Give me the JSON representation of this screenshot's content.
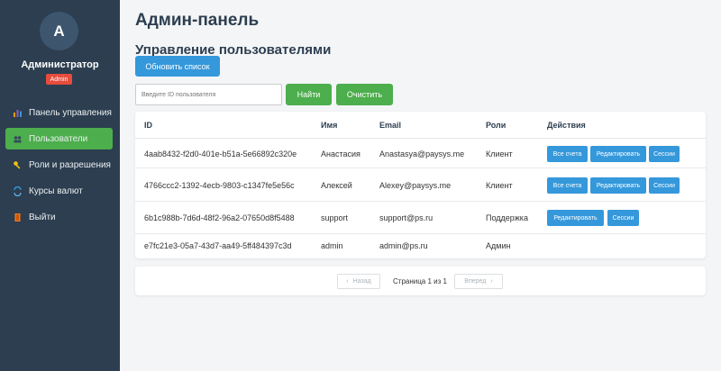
{
  "sidebar": {
    "avatar_letter": "A",
    "user_name": "Администратор",
    "role_badge": "Admin",
    "items": [
      {
        "label": "Панель управления",
        "icon": "dashboard-icon",
        "active": false
      },
      {
        "label": "Пользователи",
        "icon": "users-icon",
        "active": true
      },
      {
        "label": "Роли и разрешения",
        "icon": "key-icon",
        "active": false
      },
      {
        "label": "Курсы валют",
        "icon": "exchange-icon",
        "active": false
      },
      {
        "label": "Выйти",
        "icon": "logout-icon",
        "active": false
      }
    ]
  },
  "header": {
    "title": "Админ-панель",
    "section_title": "Управление пользователями"
  },
  "toolbar": {
    "refresh_label": "Обновить список",
    "search_placeholder": "Введите ID пользователя",
    "search_value": "",
    "find_label": "Найти",
    "clear_label": "Очистить"
  },
  "table": {
    "columns": [
      "ID",
      "Имя",
      "Email",
      "Роли",
      "Действия"
    ],
    "rows": [
      {
        "id": "4aab8432-f2d0-401e-b51a-5e66892c320e",
        "name": "Анастасия",
        "email": "Anastasya@paysys.me",
        "role": "Клиент",
        "actions": [
          "Все счета",
          "Редактировать",
          "Сессии"
        ]
      },
      {
        "id": "4766ccc2-1392-4ecb-9803-c1347fe5e56c",
        "name": "Алексей",
        "email": "Alexey@paysys.me",
        "role": "Клиент",
        "actions": [
          "Все счета",
          "Редактировать",
          "Сессии"
        ]
      },
      {
        "id": "6b1c988b-7d6d-48f2-96a2-07650d8f5488",
        "name": "support",
        "email": "support@ps.ru",
        "role": "Поддержка",
        "actions": [
          "Редактировать",
          "Сессии"
        ]
      },
      {
        "id": "e7fc21e3-05a7-43d7-aa49-5ff484397c3d",
        "name": "admin",
        "email": "admin@ps.ru",
        "role": "Админ",
        "actions": []
      }
    ]
  },
  "pagination": {
    "prev_label": "Назад",
    "next_label": "Вперед",
    "page_info": "Страница 1 из 1"
  },
  "colors": {
    "sidebar_bg": "#2c3e50",
    "accent_green": "#4cae4c",
    "accent_blue": "#3498db",
    "badge_red": "#e74c3c"
  }
}
